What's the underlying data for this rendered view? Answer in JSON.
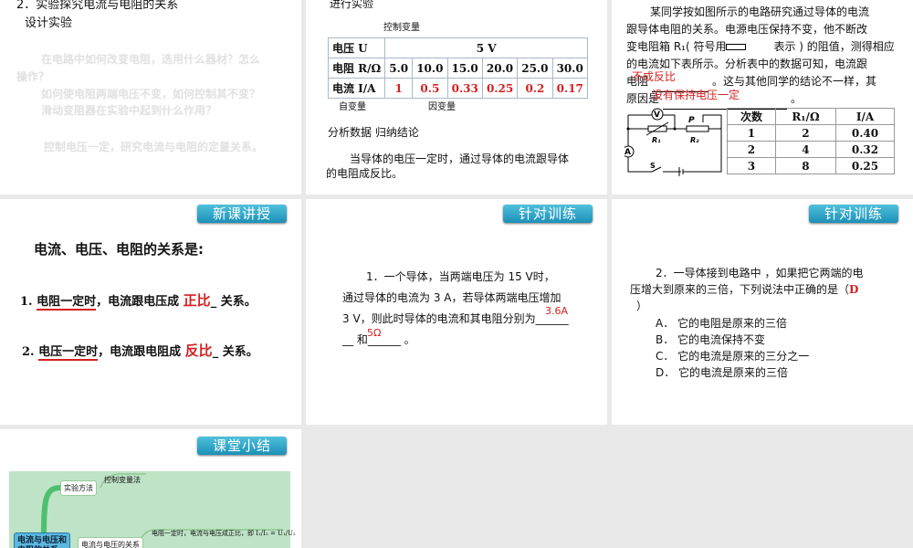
{
  "slide1": {
    "heading": "2．实验探究电流与电阻的关系",
    "sub": "设计实验",
    "q1a": "在电路中如何改变电阻，选用什么器材？怎么",
    "q1b": "操作？",
    "q2": "如何使电阻两端电压不变，如何控制其不变？",
    "q3": "滑动变阻器在实验中起到什么作用？",
    "q4": "控制电压一定，研究电流与电阻的定量关系。"
  },
  "slide2": {
    "heading": "进行实验",
    "control_label": "控制变量",
    "table": {
      "rows": [
        {
          "label": "电压 U",
          "values": [
            "5 V"
          ]
        },
        {
          "label": "电阻 R/Ω",
          "values": [
            "5.0",
            "10.0",
            "15.0",
            "20.0",
            "25.0",
            "30.0"
          ]
        },
        {
          "label": "电流 I/A",
          "values": [
            "1",
            "0.5",
            "0.33",
            "0.25",
            "0.2",
            "0.17"
          ]
        }
      ]
    },
    "independent_label": "自变量",
    "dependent_label": "因变量",
    "analysis": "分析数据  归纳结论",
    "conclusion_a": "当导体的电压一定时，通过导体的电流跟导体",
    "conclusion_b": "的电阻成反比。"
  },
  "slide3": {
    "line1": "某同学按如图所示的电路研究通过导体的电流",
    "line2": "跟导体电阻的关系。电源电压保持不变，他不断改",
    "line3a": "变电阻箱 R₁( 符号用",
    "line3b": "表示 ) 的阻值，测得相应",
    "line4": "的电流如下表所示。分析表中的数据可知，电流跟",
    "line5a": "电阻",
    "line5b": "。这与其他同学的结论不一样，其",
    "line6a": "原因是",
    "line6b": "。",
    "answer1": "不成反比",
    "answer2": "没有保持电压一定",
    "circuit": {
      "voltmeter": "V",
      "ammeter": "A",
      "r1": "R₁",
      "r2": "R₂",
      "p": "P",
      "switch": "S"
    },
    "table": {
      "headers": [
        "次数",
        "R₁/Ω",
        "I/A"
      ],
      "rows": [
        [
          "1",
          "2",
          "0.40"
        ],
        [
          "2",
          "4",
          "0.32"
        ],
        [
          "3",
          "8",
          "0.25"
        ]
      ]
    }
  },
  "slide4": {
    "tag": "新课讲授",
    "title": "电流、电压、电阻的关系是:",
    "item1": {
      "num": "1.",
      "cond": "电阻一定时",
      "mid": "，电流跟电压成",
      "ans": "正比",
      "end": "_ 关系。"
    },
    "item2": {
      "num": "2.",
      "cond": "电压一定时",
      "mid": "，电流跟电阻成",
      "ans": "反比",
      "end": "_ 关系。"
    }
  },
  "slide5": {
    "tag": "针对训练",
    "l1": "1．一个导体，当两端电压为  15 V时，",
    "l2": "通过导体的电流为  3 A，若导体两端电压增加",
    "l3": "3 V，则此时导体的电流和其电阻分别为______",
    "l4": "__ 和______ 。",
    "ans1": "3.6A",
    "ans2": "5Ω"
  },
  "slide6": {
    "tag": "针对训练",
    "l1": "2．一导体接到电路中 ，如果把它两端的电",
    "l2": "压增大到原来的三倍，下列说法中正确的是（",
    "ans": "D",
    "l3": "）",
    "options": [
      "A． 它的电阻是原来的三倍",
      "B． 它的电流保持不变",
      "C． 它的电流是原来的三分之一",
      "D． 它的电流是原来的三倍"
    ]
  },
  "slide7": {
    "tag": "课堂小结",
    "root": "电流与电压和电阻的关系",
    "n1": "实验方法",
    "n1a": "控制变量法",
    "n2": "电流与电压的关系",
    "n2a": "电阻一定时，电流与电压成正比，即 I₁/I₂ = U₁/U₂"
  }
}
